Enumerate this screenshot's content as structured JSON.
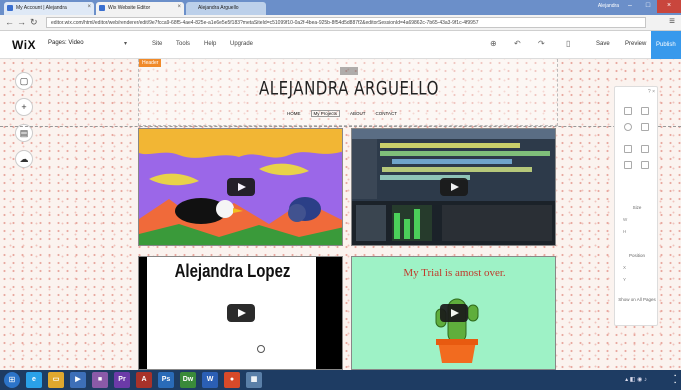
{
  "browser": {
    "tabs": [
      {
        "title": "My Account | Alejandra"
      },
      {
        "title": "Wix Website Editor"
      },
      {
        "title": "Alejandra Arguello"
      }
    ],
    "user": "Alejandra",
    "url": "editor.wix.com/html/editor/web/renderer/edit/9e7fcca9-68f5-4ae4-825e-a1e6e5e5f183?metaSiteId=c51099f10-0a2f-4bea-925b-8f54d5d887f2&editorSessionId=4a69862c-7b65-43a3-9f1c-4f9957"
  },
  "editor": {
    "logo": "WiX",
    "page_selector": "Pages: Video",
    "menu": [
      "Site",
      "Tools",
      "Help",
      "Upgrade"
    ],
    "save": "Save",
    "preview": "Preview",
    "publish": "Publish"
  },
  "site": {
    "header_tag": "Header",
    "title": "ALEJANDRA ARGUELLO",
    "nav": [
      "HOME",
      "My Projects",
      "ABOUT",
      "CONTACT"
    ],
    "videos": [
      {
        "title": ""
      },
      {
        "title": ""
      },
      {
        "title": "Alejandra Lopez"
      },
      {
        "title": "My Trial is amost over."
      }
    ]
  },
  "panel": {
    "size": "Size",
    "position": "Position",
    "show_all_pages": "Show on All Pages",
    "w": "W",
    "h": "H",
    "x": "X",
    "y": "Y"
  },
  "colors": {
    "wix_blue": "#3899ec",
    "header_tag": "#f08a2a",
    "taskbar": "#1e3c63"
  },
  "icons": {
    "left_tools": [
      "page-icon",
      "add-icon",
      "background-icon",
      "upload-icon"
    ]
  }
}
